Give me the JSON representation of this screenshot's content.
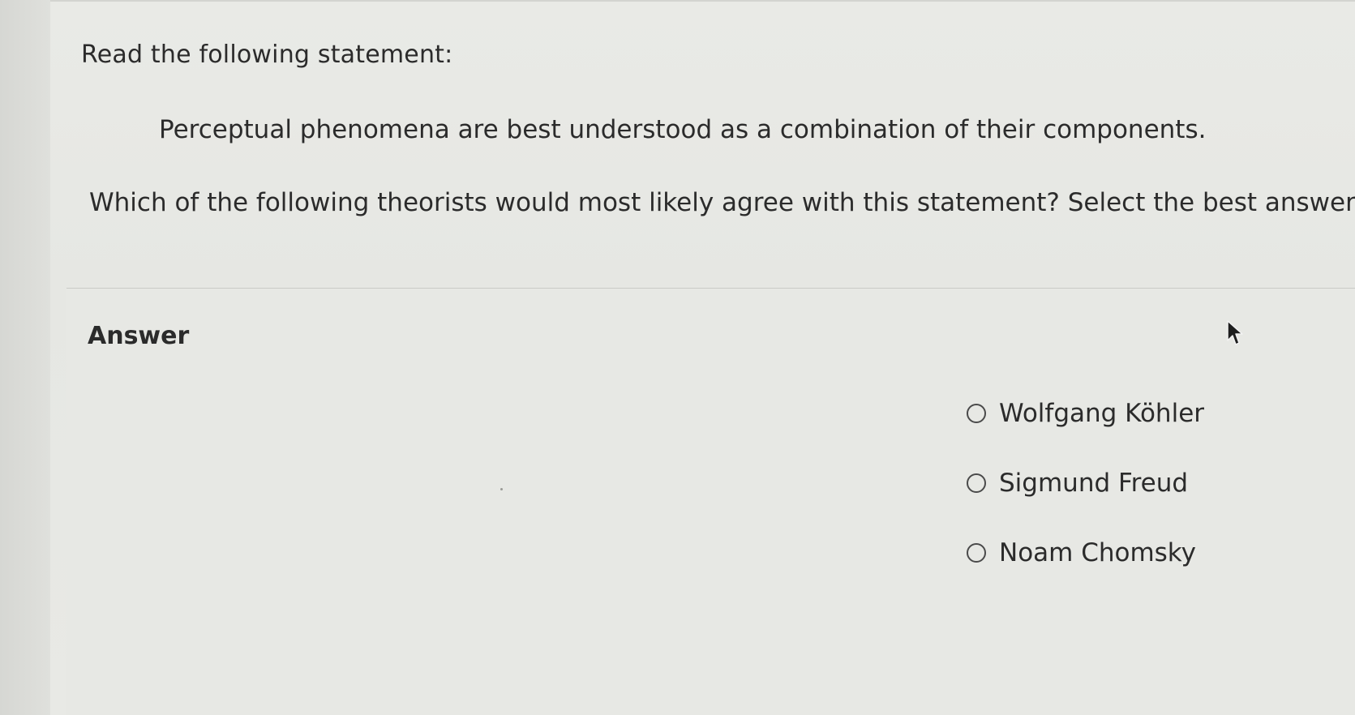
{
  "prompt": "Read the following statement:",
  "statement": "Perceptual phenomena are best understood as a combination of their components.",
  "question": "Which of the following theorists would most likely agree with this statement? Select the best answer.",
  "answer_heading": "Answer",
  "options": [
    {
      "label": "Wolfgang Köhler",
      "selected": false
    },
    {
      "label": "Sigmund Freud",
      "selected": false
    },
    {
      "label": "Noam Chomsky",
      "selected": false
    }
  ],
  "icons": {
    "cursor": "mouse-pointer-icon",
    "radio": "radio-unselected-icon"
  },
  "colors": {
    "text": "#2b2b2b",
    "background": "#e7e8e4",
    "divider": "#c9cac6"
  }
}
